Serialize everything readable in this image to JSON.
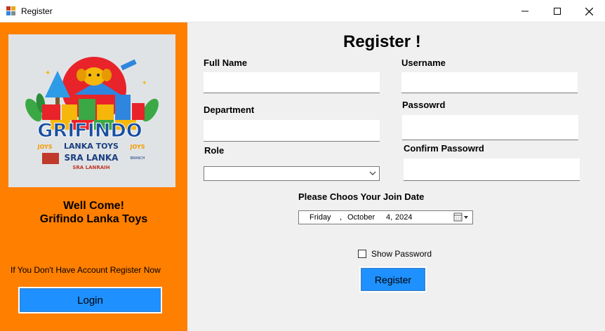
{
  "window": {
    "title": "Register",
    "icons": [
      "app-icon",
      "minimize-icon",
      "maximize-icon",
      "close-icon"
    ]
  },
  "left_panel": {
    "logo": {
      "title": "GRIFINDO",
      "line1": "LANKA TOYS",
      "line1_decor_left": "JOYS",
      "line1_decor_right": "JOYS",
      "line2": "SRA LANKA",
      "line2_small": "BRANCH",
      "line3": "SRA LANRAIH"
    },
    "welcome_line1": "Well Come!",
    "welcome_line2": "Grifindo Lanka Toys",
    "hint": "If You Don't Have Account Register Now",
    "login_label": "Login"
  },
  "form": {
    "heading": "Register !",
    "full_name_label": "Full Name",
    "full_name_value": "",
    "username_label": "Username",
    "username_value": "",
    "department_label": "Department",
    "department_value": "",
    "password_label": "Passowrd",
    "password_value": "",
    "role_label": "Role",
    "role_value": "",
    "confirm_password_label": "Confirm Passowrd",
    "confirm_password_value": "",
    "join_date_label": "Please Choos Your Join Date",
    "date": {
      "weekday": "Friday",
      "sep": ",",
      "month": "October",
      "day": "4,",
      "year": "2024"
    },
    "show_password_label": "Show Password",
    "show_password_checked": false,
    "register_label": "Register"
  },
  "colors": {
    "left_panel": "#ff7f00",
    "button": "#1e90ff",
    "background": "#f0f0f0"
  }
}
